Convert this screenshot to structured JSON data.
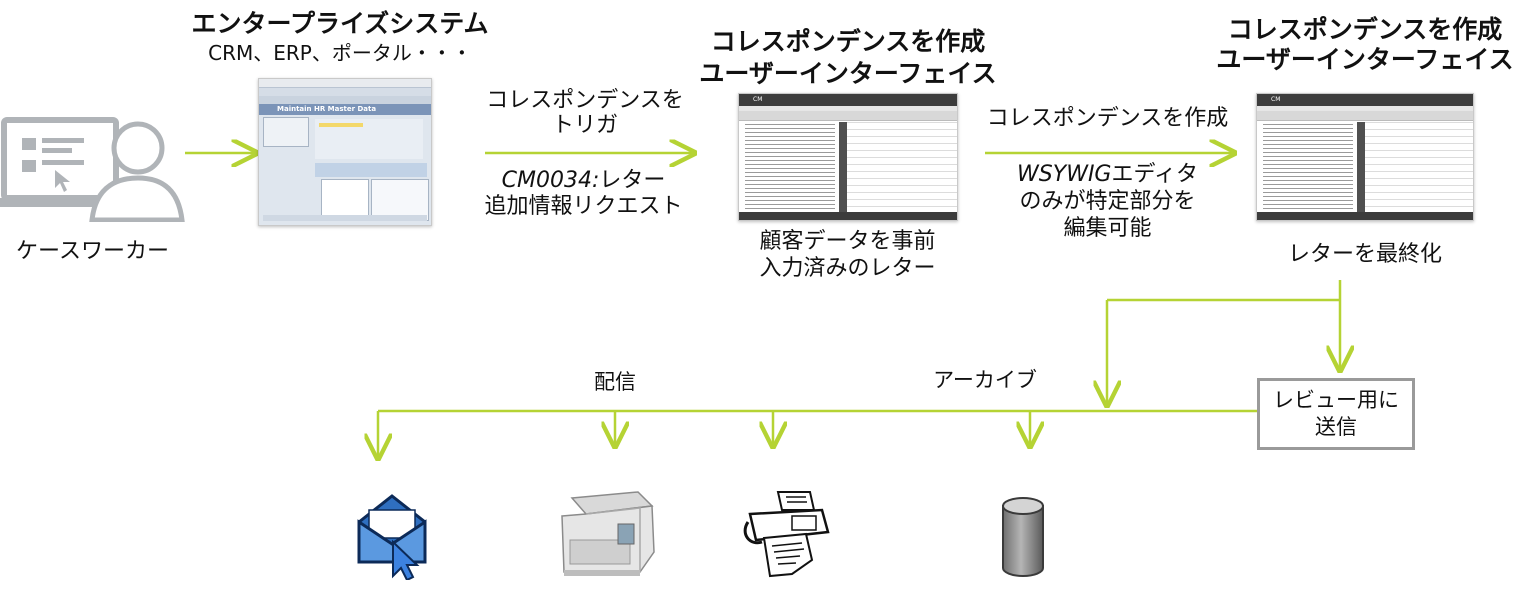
{
  "caseworker": {
    "label": "ケースワーカー"
  },
  "enterprise": {
    "title": "エンタープライズシステム",
    "subtitle": "CRM、ERP、ポータル・・・",
    "screen_title": "Maintain HR Master Data"
  },
  "trigger": {
    "label": "コレスポンデンスをトリガ",
    "code": "CM0034:",
    "detail_line1": "レター",
    "detail_line2": "追加情報リクエスト"
  },
  "ui1": {
    "title_line1": "コレスポンデンスを作成",
    "title_line2": "ユーザーインターフェイス",
    "caption_line1": "顧客データを事前",
    "caption_line2": "入力済みのレター",
    "app_name": "CM"
  },
  "create": {
    "label": "コレスポンデンスを作成",
    "editor_prefix": "WSYWIG",
    "editor_suffix": "エディタ",
    "editor_line2": "のみが特定部分を",
    "editor_line3": "編集可能"
  },
  "ui2": {
    "title_line1": "コレスポンデンスを作成",
    "title_line2": "ユーザーインターフェイス",
    "caption": "レターを最終化",
    "app_name": "CM"
  },
  "review": {
    "label_line1": "レビュー用に",
    "label_line2": "送信"
  },
  "outputs": {
    "delivery": "配信",
    "archive": "アーカイブ"
  },
  "icons": [
    "person-monitor-icon",
    "email-icon",
    "printer-icon",
    "fax-icon",
    "database-icon"
  ],
  "colors": {
    "arrow": "#b5d334",
    "box_border": "#9a9a9a",
    "screen_dark": "#3c3c3c"
  }
}
